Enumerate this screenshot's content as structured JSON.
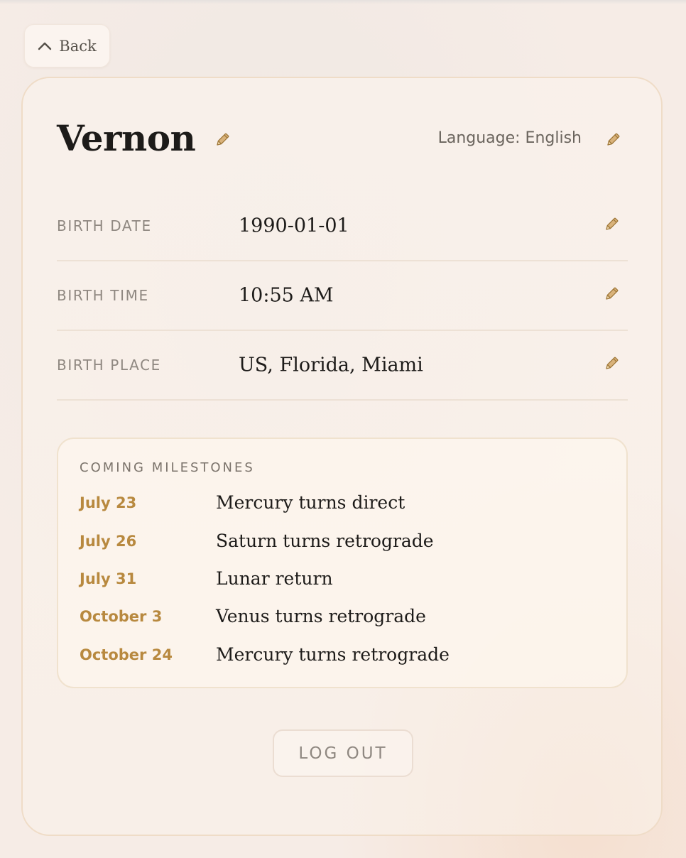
{
  "back_button": {
    "label": "Back",
    "icon": "chevron-up-icon"
  },
  "profile": {
    "name": "Vernon",
    "language_label": "Language: English"
  },
  "fields": [
    {
      "label": "BIRTH DATE",
      "value": "1990-01-01"
    },
    {
      "label": "BIRTH TIME",
      "value": "10:55 AM"
    },
    {
      "label": "BIRTH PLACE",
      "value": "US, Florida, Miami"
    }
  ],
  "milestones": {
    "title": "COMING MILESTONES",
    "items": [
      {
        "date": "July 23",
        "event": "Mercury turns direct"
      },
      {
        "date": "July 26",
        "event": "Saturn turns retrograde"
      },
      {
        "date": "July 31",
        "event": "Lunar return"
      },
      {
        "date": "October 3",
        "event": "Venus turns retrograde"
      },
      {
        "date": "October 24",
        "event": "Mercury turns retrograde"
      }
    ]
  },
  "logout_button": {
    "label": "LOG OUT"
  },
  "colors": {
    "accent_gold": "#b8893f",
    "text_dark": "#1d1b19",
    "text_muted": "#8f8881",
    "background": "#f6ece6"
  }
}
